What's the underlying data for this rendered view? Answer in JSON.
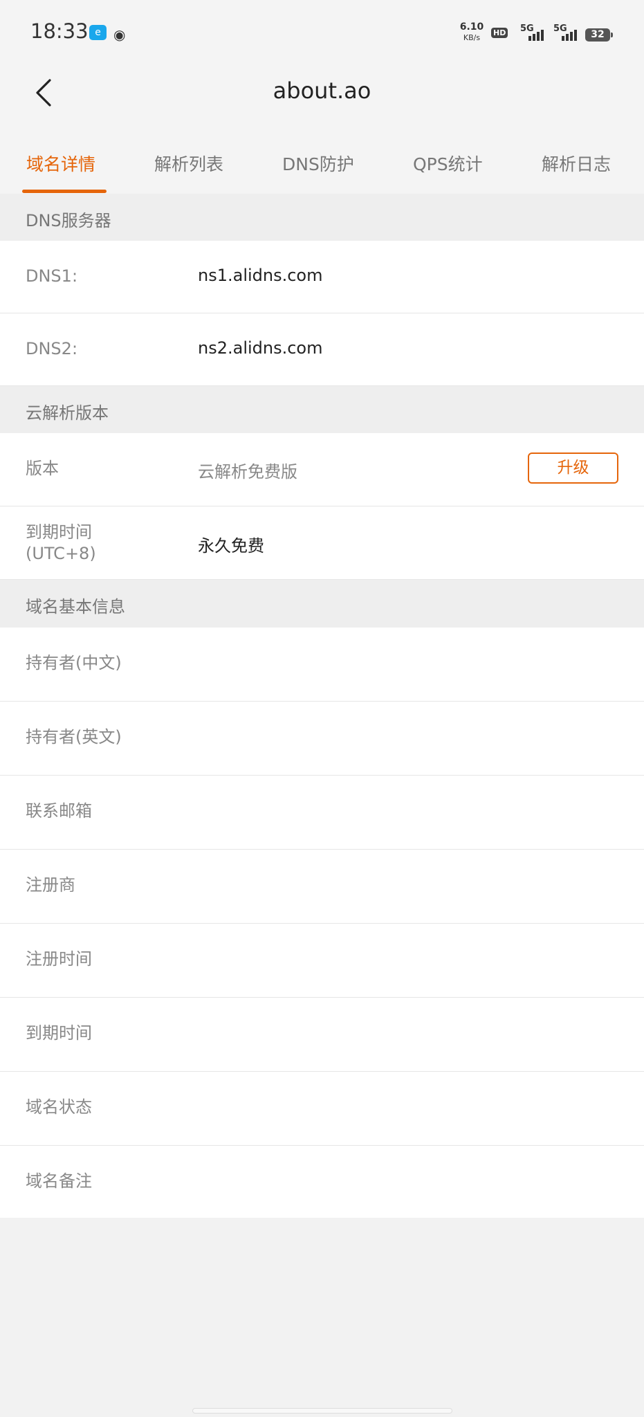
{
  "status_bar": {
    "time": "18:33",
    "net_speed": "6.10",
    "net_unit": "KB/s",
    "hd": "HD",
    "net1": "5G",
    "net2": "5G",
    "battery": "32"
  },
  "header": {
    "title": "about.ao"
  },
  "tabs": [
    {
      "label": "域名详情",
      "active": true
    },
    {
      "label": "解析列表",
      "active": false
    },
    {
      "label": "DNS防护",
      "active": false
    },
    {
      "label": "QPS统计",
      "active": false
    },
    {
      "label": "解析日志",
      "active": false
    }
  ],
  "sections": {
    "dns_servers": {
      "title": "DNS服务器",
      "rows": [
        {
          "label": "DNS1:",
          "value": "ns1.alidns.com"
        },
        {
          "label": "DNS2:",
          "value": "ns2.alidns.com"
        }
      ]
    },
    "version": {
      "title": "云解析版本",
      "version_label": "版本",
      "version_value": "云解析免费版",
      "upgrade_label": "升级",
      "expiry_label_1": "到期时间",
      "expiry_label_2": "(UTC+8)",
      "expiry_value": "永久免费"
    },
    "basic_info": {
      "title": "域名基本信息",
      "rows": [
        {
          "label": "持有者(中文)"
        },
        {
          "label": "持有者(英文)"
        },
        {
          "label": "联系邮箱"
        },
        {
          "label": "注册商"
        },
        {
          "label": "注册时间"
        },
        {
          "label": "到期时间"
        },
        {
          "label": "域名状态"
        },
        {
          "label": "域名备注"
        }
      ]
    }
  },
  "colors": {
    "accent": "#e5650a",
    "background": "#f2f2f2",
    "section_bg": "#eeeeee"
  }
}
